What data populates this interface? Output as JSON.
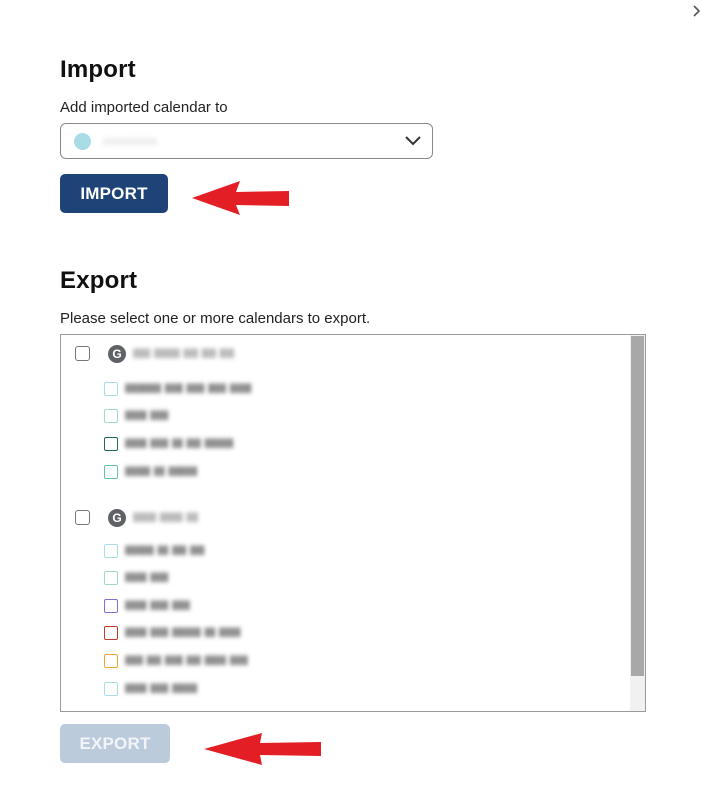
{
  "import": {
    "title": "Import",
    "field_label": "Add imported calendar to",
    "selected_calendar": "ııııııııııııııı",
    "selected_color": "#a8dde6",
    "button_label": "IMPORT",
    "button_color": "#1e4477"
  },
  "export": {
    "title": "Export",
    "instructions": "Please select one or more calendars to export.",
    "button_label": "EXPORT",
    "button_color": "#bccbdc",
    "accounts": [
      {
        "icon_letter": "G",
        "name": "llllll lllllllll lllll lllll lllll",
        "calendars": [
          {
            "name": "llllllllll lllll lllll lllll llllll",
            "color": "#a8dde6"
          },
          {
            "name": "llllll lllll",
            "color": "#9fd9c4"
          },
          {
            "name": "llllll lllll lll llll llllllll",
            "color": "#1f6b4a"
          },
          {
            "name": "lllllll lll llllllll",
            "color": "#5fc79b"
          }
        ]
      },
      {
        "icon_letter": "G",
        "name": "llllllll llllllll llll",
        "calendars": [
          {
            "name": "llllllll lll llll llll",
            "color": "#a8dde6"
          },
          {
            "name": "llllll lllll",
            "color": "#9fd9c4"
          },
          {
            "name": "llllll lllll lllll",
            "color": "#8a6bd1"
          },
          {
            "name": "llllll lllll llllllll lll llllll",
            "color": "#c63a2b"
          },
          {
            "name": "lllll llll lllll llll llllll lllll",
            "color": "#f0a33b"
          },
          {
            "name": "llllll lllll lllllll",
            "color": "#a8dde6"
          }
        ]
      }
    ]
  },
  "icons": {
    "nav": "chevron-right-icon",
    "dropdown": "chevron-down-icon",
    "account": "google-icon",
    "annotation": "red-arrow-icon"
  }
}
